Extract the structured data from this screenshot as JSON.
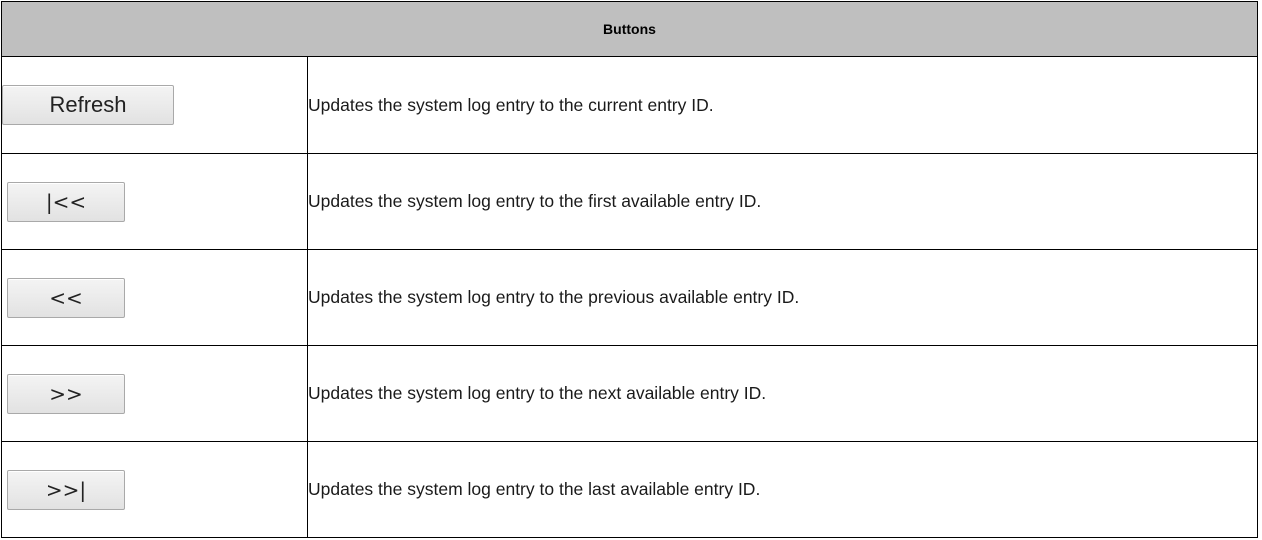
{
  "table": {
    "header": "Buttons",
    "rows": [
      {
        "button": "Refresh",
        "description": "Updates the system log entry to the current entry ID."
      },
      {
        "button": "|<<",
        "description": "Updates the system log entry to the first available entry ID."
      },
      {
        "button": "<<",
        "description": "Updates the system log entry to the previous available entry ID."
      },
      {
        "button": ">>",
        "description": "Updates the system log entry to the next available entry ID."
      },
      {
        "button": ">>|",
        "description": "Updates the system log entry to the last available entry ID."
      }
    ]
  },
  "colors": {
    "header_background": "#bfbfbf",
    "border": "#000000",
    "button_face": "#e8e8e8"
  }
}
